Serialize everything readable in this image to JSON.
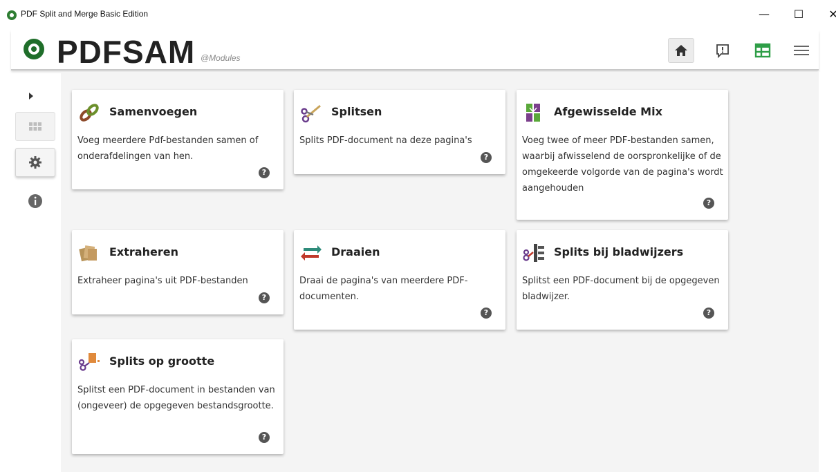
{
  "window": {
    "title": "PDF Split and Merge Basic Edition",
    "minimize": "—",
    "maximize": "☐",
    "close": "✕"
  },
  "header": {
    "logo_text": "PDFSAM",
    "logo_sub": "@Modules",
    "buttons": [
      {
        "name": "home",
        "icon": "home-icon"
      },
      {
        "name": "feedback",
        "icon": "feedback-icon"
      },
      {
        "name": "dashboard",
        "icon": "dashboard-icon"
      },
      {
        "name": "menu",
        "icon": "hamburger-menu-icon"
      }
    ]
  },
  "sidebar": {
    "items": [
      {
        "name": "expand",
        "icon": "chevron-right-icon"
      },
      {
        "name": "modules",
        "icon": "grid-icon"
      },
      {
        "name": "settings",
        "icon": "gear-icon"
      },
      {
        "name": "info",
        "icon": "info-icon"
      }
    ]
  },
  "modules": [
    {
      "title": "Samenvoegen",
      "description": "Voeg meerdere Pdf-bestanden samen of onderafdelingen van hen.",
      "icon": "merge-chain-icon",
      "help": "?"
    },
    {
      "title": "Splitsen",
      "description": "Splits PDF-document na deze pagina's",
      "icon": "split-scissors-icon",
      "help": "?"
    },
    {
      "title": "Afgewisselde Mix",
      "description": "Voeg twee of meer PDF-bestanden samen, waarbij afwisselend de oorspronkelijke of de omgekeerde volgorde van de pagina's wordt aangehouden",
      "icon": "alternate-mix-icon",
      "help": "?"
    },
    {
      "title": "Extraheren",
      "description": "Extraheer pagina's uit PDF-bestanden",
      "icon": "extract-pages-icon",
      "help": "?"
    },
    {
      "title": "Draaien",
      "description": "Draai de pagina's van meerdere PDF-documenten.",
      "icon": "rotate-icon",
      "help": "?"
    },
    {
      "title": "Splits bij bladwijzers",
      "description": "Splitst een PDF-document bij de opgegeven bladwijzer.",
      "icon": "split-bookmarks-icon",
      "help": "?"
    },
    {
      "title": "Splits op grootte",
      "description": "Splitst een PDF-document in bestanden van (ongeveer) de opgegeven bestandsgrootte.",
      "icon": "split-size-icon",
      "help": "?"
    }
  ],
  "colors": {
    "accent_green": "#2e9e47",
    "content_bg": "#f4f4f4"
  }
}
